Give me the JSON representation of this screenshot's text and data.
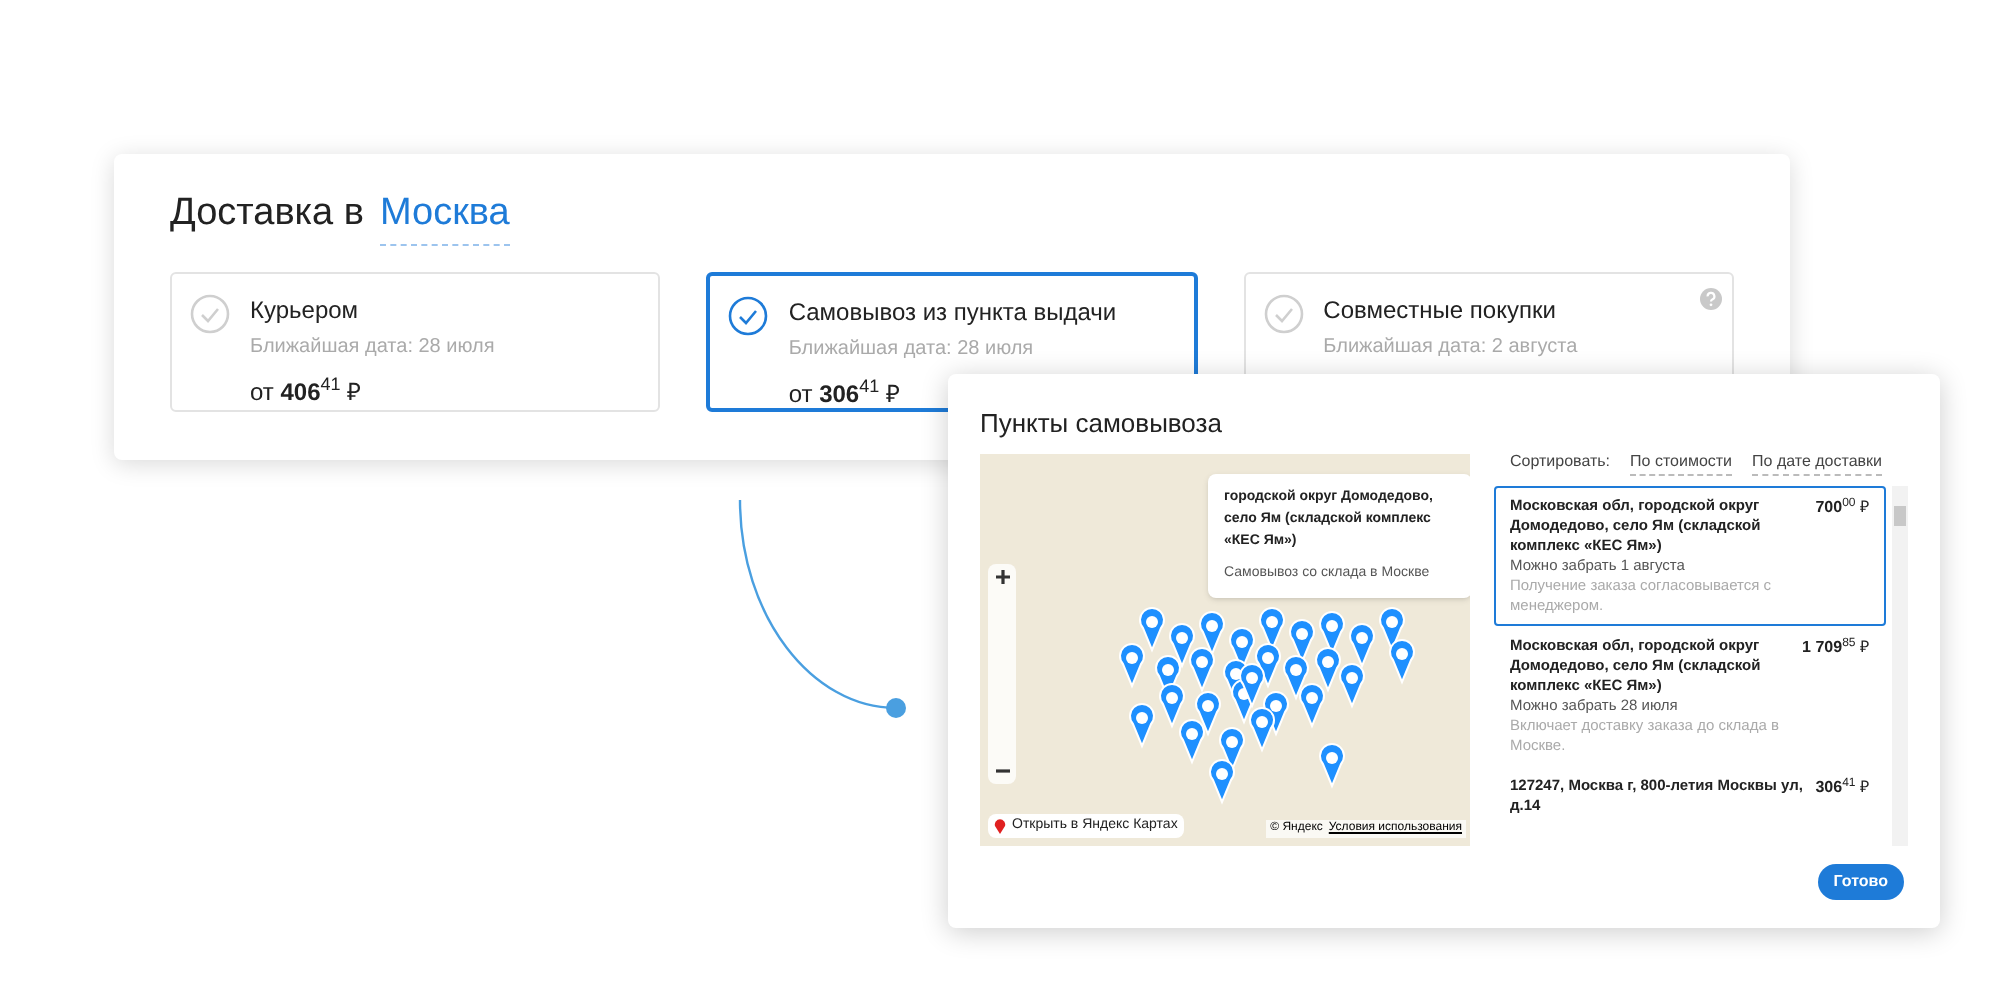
{
  "delivery": {
    "title": "Доставка в",
    "city": "Москва"
  },
  "options": [
    {
      "label": "Курьером",
      "date": "Ближайшая дата: 28 июля",
      "price": "от **406**$^{41}$ ₽",
      "selected": false,
      "help": false
    },
    {
      "label": "Самовывоз из пункта выдачи",
      "date": "Ближайшая дата: 28 июля",
      "price": "от **306**$^{41}$ ₽",
      "selected": true,
      "help": false
    },
    {
      "label": "Совместные покупки",
      "date": "Ближайшая дата: 2 августа",
      "selected": false,
      "help": true
    }
  ],
  "modal": {
    "title": "Пункты самовывоза",
    "map": {
      "balloon_title": "городской округ Домодедово, село Ям (складской комплекс «КЕС Ям»)",
      "balloon_text": "Самовывоз со склада в Москве",
      "open_link": "Открыть в Яндекс Картах",
      "copyright": "© Яндекс",
      "terms": "Условия использования"
    },
    "sort": {
      "label": "Сортировать:",
      "options": [
        "По стоимости",
        "По дате доставки"
      ]
    },
    "points": [
      {
        "address": "Московская обл, городской округ Домодедово, село Ям (складской комплекс «КЕС Ям»)",
        "price": "**700**$^{00}$ ₽",
        "pickup": "Можно забрать 1 августа",
        "note": "Получение заказа согласовывается с менеджером.",
        "selected": true
      },
      {
        "address": "Московская обл, городской округ Домодедово, село Ям (складской комплекс «КЕС Ям»)",
        "price": "**1 709**$^{85}$ ₽",
        "pickup": "Можно забрать 28 июля",
        "note": "Включает доставку заказа до склада в Москве.",
        "selected": false
      },
      {
        "address": "127247, Москва г, 800-летия Москвы ул, д.14",
        "price": "**306**$^{41}$ ₽",
        "selected": false
      }
    ],
    "done_button": "Готово"
  }
}
